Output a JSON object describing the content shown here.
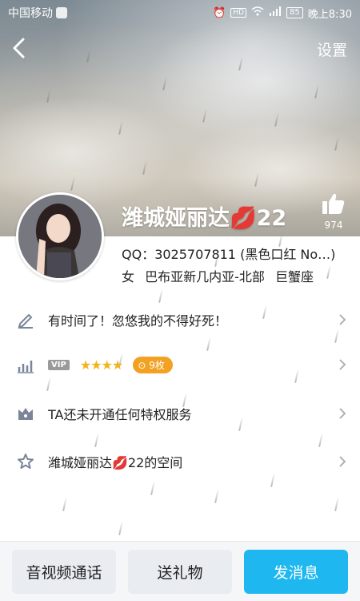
{
  "status_bar": {
    "carrier": "中国移动",
    "battery": "85",
    "time": "晚上8:30"
  },
  "nav": {
    "back_icon": "chevron-left-icon",
    "settings_label": "设置"
  },
  "profile": {
    "name": "潍城娅丽达💋22",
    "like_count": "974",
    "qq_line": "QQ：3025707811 (黑色口红 No…)",
    "gender": "女",
    "location": "巴布亚新几内亚-北部",
    "zodiac": "巨蟹座"
  },
  "rows": {
    "signature": "有时间了！忽悠我的不得好死！",
    "vip_label": "VIP",
    "vip_stars": "★★★★",
    "coins": "9枚",
    "privilege": "TA还未开通任何特权服务",
    "space": "潍城娅丽达💋22的空间"
  },
  "actions": {
    "call": "音视频通话",
    "gift": "送礼物",
    "message": "发消息"
  },
  "colors": {
    "accent": "#1fb7ef",
    "coin": "#f2a122",
    "icon": "#7a8599"
  }
}
